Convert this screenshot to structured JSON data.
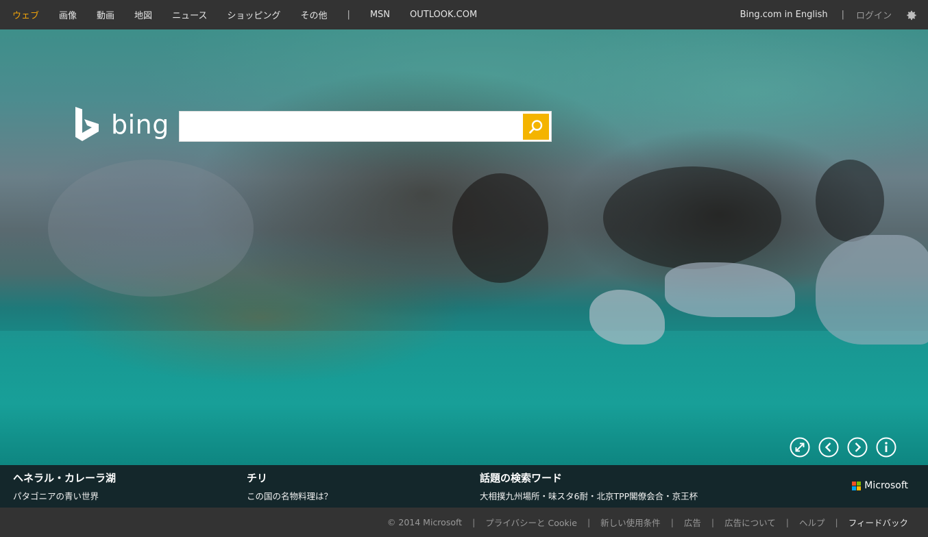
{
  "nav": {
    "left": [
      {
        "label": "ウェブ",
        "active": true
      },
      {
        "label": "画像"
      },
      {
        "label": "動画"
      },
      {
        "label": "地図"
      },
      {
        "label": "ニュース"
      },
      {
        "label": "ショッピング"
      },
      {
        "label": "その他"
      }
    ],
    "separator": "|",
    "extra": [
      "MSN",
      "OUTLOOK.COM"
    ],
    "english_link": "Bing.com in English",
    "right_separator": "|",
    "login": "ログイン",
    "settings_icon": "gear-icon"
  },
  "logo": {
    "text": "bing"
  },
  "search": {
    "value": "",
    "placeholder": "",
    "button_icon": "search-icon"
  },
  "controls": [
    "expand-icon",
    "previous-icon",
    "next-icon",
    "info-icon"
  ],
  "info": [
    {
      "head": "ヘネラル・カレーラ湖",
      "sub": "パタゴニアの青い世界"
    },
    {
      "head": "チリ",
      "sub": "この国の名物料理は？"
    },
    {
      "head": "話題の検索ワード",
      "sub": "大相撲九州場所・味スタ6耐・北京TPP閣僚会合・京王杯"
    }
  ],
  "microsoft_brand": "Microsoft",
  "footer": {
    "copyright": "© 2014 Microsoft",
    "separator": "|",
    "links": [
      "プライバシーと Cookie",
      "新しい使用条件",
      "広告",
      "広告について",
      "ヘルプ"
    ],
    "feedback": "フィードバック"
  },
  "colors": {
    "bar": "#333333",
    "active_nav": "#f0a30a",
    "search_button": "#f4b400",
    "ms_red": "#f25022",
    "ms_green": "#7fba00",
    "ms_blue": "#00a4ef",
    "ms_yellow": "#ffb900"
  }
}
